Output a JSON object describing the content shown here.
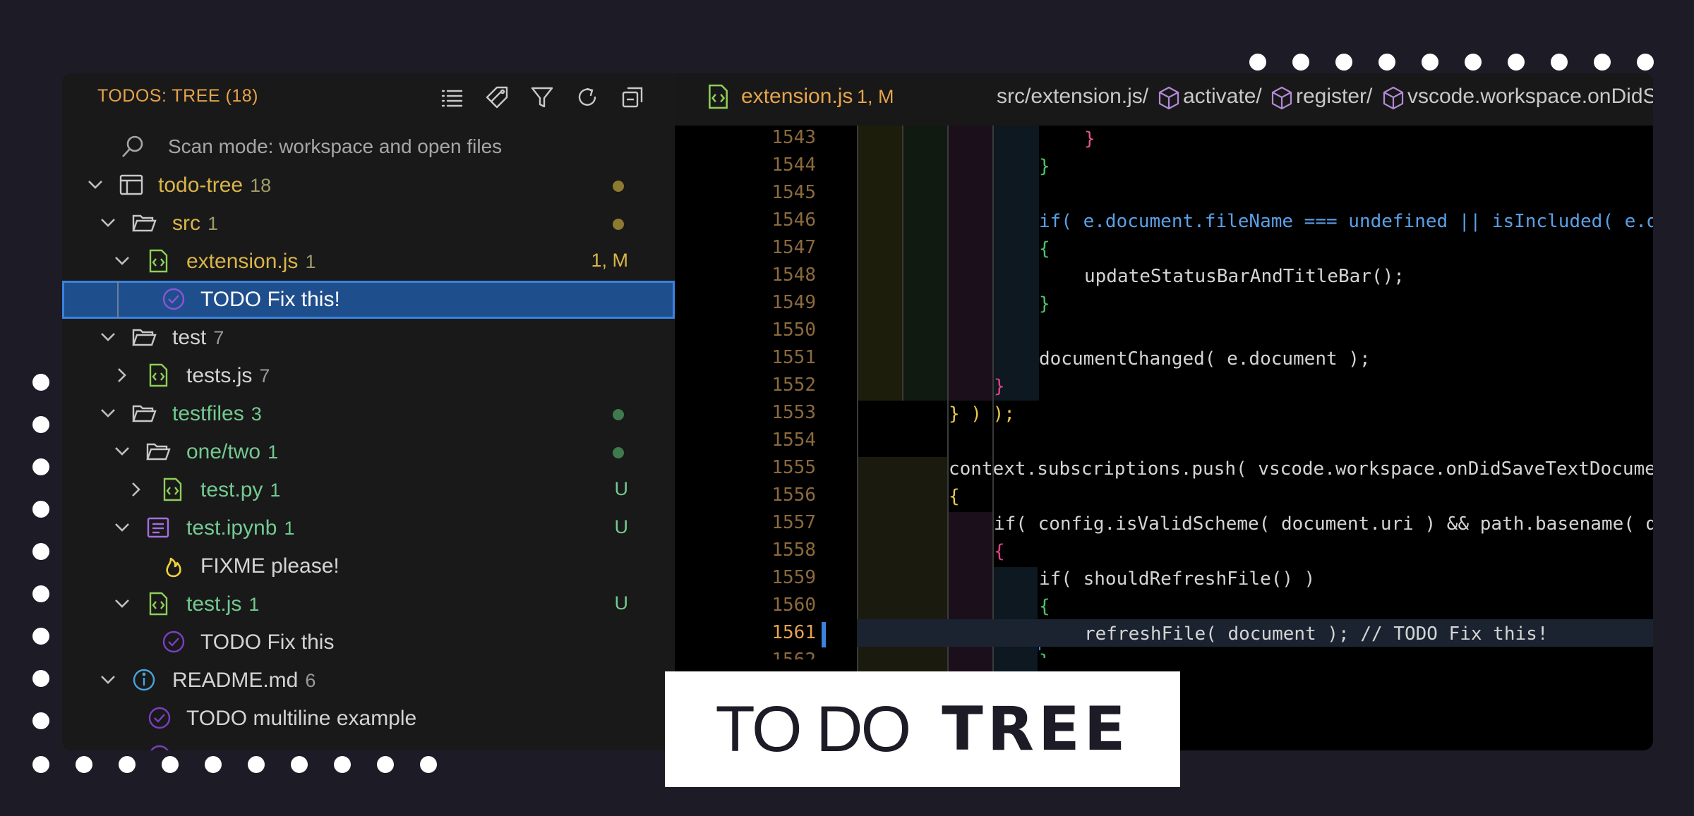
{
  "colors": {
    "background": "#1c1b26",
    "accent_orange": "#e6a34a",
    "selection": "#1f4e8c",
    "added_green": "#73c991",
    "todo_highlight": "#7b2fa8"
  },
  "sidebar": {
    "title": "TODOS: TREE (18)",
    "toolbar_icons": [
      "list-icon",
      "tag-icon",
      "filter-icon",
      "refresh-icon",
      "collapse-all-icon"
    ],
    "search_text": "Scan mode: workspace and open files",
    "tree": [
      {
        "label": "todo-tree",
        "count": "18",
        "icon": "window-icon",
        "status": "dot"
      },
      {
        "label": "src",
        "count": "1",
        "icon": "folder-icon",
        "status": "dot"
      },
      {
        "label": "extension.js",
        "count": "1",
        "icon": "js-file-icon",
        "status": "1, M"
      },
      {
        "label": "TODO Fix this!",
        "icon": "check-circle-icon",
        "selected": true
      },
      {
        "label": "test",
        "count": "7",
        "icon": "folder-icon"
      },
      {
        "label": "tests.js",
        "count": "7",
        "icon": "js-file-icon"
      },
      {
        "label": "testfiles",
        "count": "3",
        "icon": "folder-icon",
        "status": "dot"
      },
      {
        "label": "one/two",
        "count": "1",
        "icon": "folder-icon",
        "status": "dot"
      },
      {
        "label": "test.py",
        "count": "1",
        "icon": "py-file-icon",
        "status": "U"
      },
      {
        "label": "test.ipynb",
        "count": "1",
        "icon": "notebook-icon",
        "status": "U"
      },
      {
        "label": "FIXME please!",
        "icon": "flame-icon"
      },
      {
        "label": "test.js",
        "count": "1",
        "icon": "js-file-icon",
        "status": "U"
      },
      {
        "label": "TODO Fix this",
        "icon": "check-circle-icon"
      },
      {
        "label": "README.md",
        "count": "6",
        "icon": "info-icon"
      },
      {
        "label": "TODO multiline example",
        "icon": "check-circle-icon"
      }
    ]
  },
  "editor": {
    "tab": {
      "filename": "extension.js",
      "status": "1, M",
      "path": "src/extension.js/",
      "crumbs": [
        "activate/",
        "register/",
        "vscode.workspace.onDidSaveTe"
      ]
    },
    "lines": [
      {
        "n": "1543",
        "text": "}"
      },
      {
        "n": "1544",
        "text": "}"
      },
      {
        "n": "1545",
        "text": ""
      },
      {
        "n": "1546",
        "text": "if( e.document.fileName === undefined || isIncluded( e.docu"
      },
      {
        "n": "1547",
        "text": "{"
      },
      {
        "n": "1548",
        "text": "updateStatusBarAndTitleBar();"
      },
      {
        "n": "1549",
        "text": "}"
      },
      {
        "n": "1550",
        "text": ""
      },
      {
        "n": "1551",
        "text": "documentChanged( e.document );"
      },
      {
        "n": "1552",
        "text": "}"
      },
      {
        "n": "1553",
        "text": "} ) );"
      },
      {
        "n": "1554",
        "text": ""
      },
      {
        "n": "1555",
        "text": "context.subscriptions.push( vscode.workspace.onDidSaveTextDocument"
      },
      {
        "n": "1556",
        "text": "{"
      },
      {
        "n": "1557",
        "text": "if( config.isValidScheme( document.uri ) && path.basename( docu"
      },
      {
        "n": "1558",
        "text": "{"
      },
      {
        "n": "1559",
        "text": "if( shouldRefreshFile() )"
      },
      {
        "n": "1560",
        "text": "{"
      },
      {
        "n": "1561",
        "text": "refreshFile( document ); // TODO Fix this!"
      },
      {
        "n": "1562",
        "text": "}"
      }
    ]
  },
  "brand": {
    "part1": "TO DO",
    "part2": "TREE"
  }
}
